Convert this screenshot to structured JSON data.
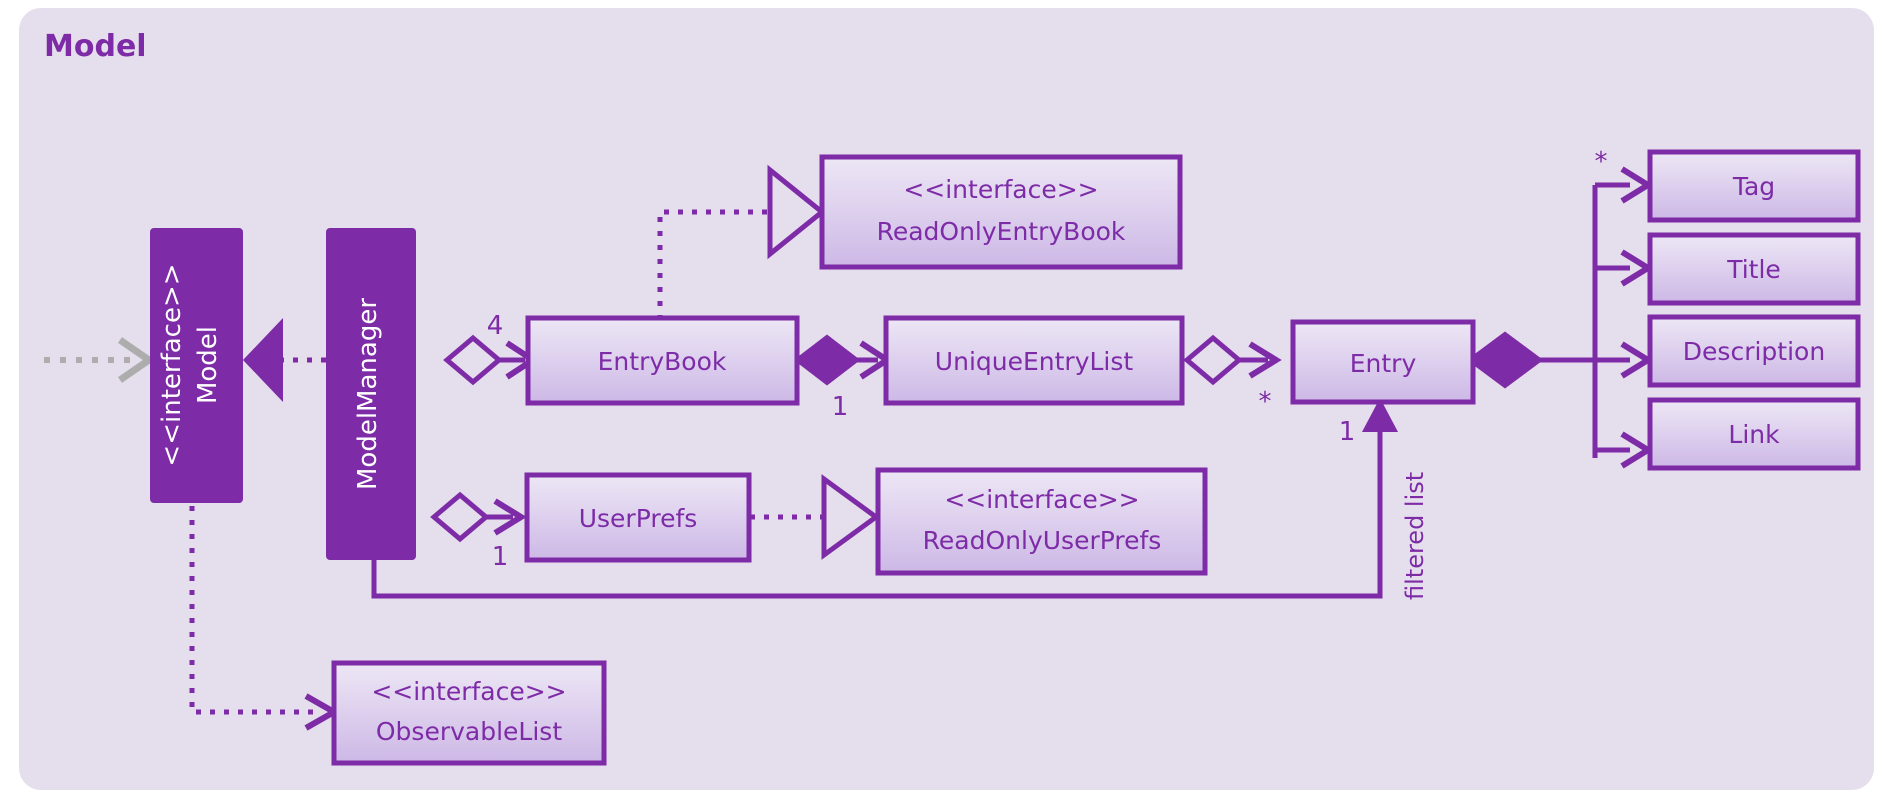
{
  "diagram": {
    "title": "Model",
    "type": "uml-class-diagram",
    "colors": {
      "panel_background": "#E5DEEC",
      "accent_purple": "#7D2BA6",
      "solid_box_fill": "#7D2BA6",
      "solid_box_text": "#FFFFFF",
      "light_box_fill_top": "#EDE7F5",
      "light_box_fill_bottom": "#CDB8E6",
      "external_arrow_gray": "#ADADAD"
    }
  },
  "nodes": {
    "model_interface": {
      "stereotype": "<<interface>>",
      "name": "Model",
      "style": "solid",
      "orientation": "vertical"
    },
    "model_manager": {
      "name": "ModelManager",
      "style": "solid",
      "orientation": "vertical"
    },
    "readonly_entry_book": {
      "stereotype": "<<interface>>",
      "name": "ReadOnlyEntryBook",
      "style": "light"
    },
    "entry_book": {
      "name": "EntryBook",
      "style": "light"
    },
    "unique_entry_list": {
      "name": "UniqueEntryList",
      "style": "light"
    },
    "entry": {
      "name": "Entry",
      "style": "light"
    },
    "user_prefs": {
      "name": "UserPrefs",
      "style": "light"
    },
    "readonly_user_prefs": {
      "stereotype": "<<interface>>",
      "name": "ReadOnlyUserPrefs",
      "style": "light"
    },
    "observable_list": {
      "stereotype": "<<interface>>",
      "name": "ObservableList",
      "style": "light"
    },
    "tag": {
      "name": "Tag",
      "style": "light"
    },
    "title_attr": {
      "name": "Title",
      "style": "light"
    },
    "description": {
      "name": "Description",
      "style": "light"
    },
    "link": {
      "name": "Link",
      "style": "light"
    }
  },
  "multiplicities": {
    "model_manager_entry_book": "4",
    "entry_book_unique_entry_list": "1",
    "unique_entry_list_entry": "*",
    "entry_filtered_list": "1",
    "model_manager_user_prefs": "1",
    "entry_tag": "*"
  },
  "edge_labels": {
    "filtered_list": "filtered list"
  }
}
